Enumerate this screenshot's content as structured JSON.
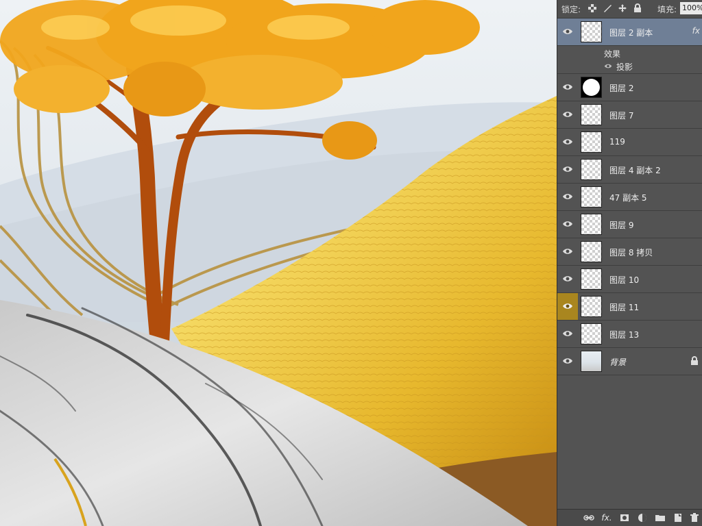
{
  "canvas": {
    "description_icons": [
      "tree",
      "gold-line-waves",
      "gold-hill",
      "marble-slope"
    ]
  },
  "panel": {
    "lock_label": "锁定:",
    "fill_label": "填充:",
    "fill_value": "100%",
    "lock_icons": [
      "lock-transparent-icon",
      "lock-brush-icon",
      "lock-move-icon",
      "lock-all-icon"
    ],
    "effects": {
      "title": "效果",
      "item": "投影"
    },
    "layers": [
      {
        "name": "图层 2 副本",
        "thumb": "checker",
        "selected": true,
        "fx": "fx"
      },
      {
        "name": "图层 2",
        "thumb": "circle"
      },
      {
        "name": "图层 7",
        "thumb": "checker"
      },
      {
        "name": "119",
        "thumb": "checker"
      },
      {
        "name": "图层 4 副本 2",
        "thumb": "checker"
      },
      {
        "name": "47 副本 5",
        "thumb": "checker"
      },
      {
        "name": "图层 9",
        "thumb": "checker"
      },
      {
        "name": "图层 8 拷贝",
        "thumb": "checker"
      },
      {
        "name": "图层 10",
        "thumb": "checker"
      },
      {
        "name": "图层 11",
        "thumb": "checker",
        "eye_highlight": true
      },
      {
        "name": "图层 13",
        "thumb": "checker"
      },
      {
        "name": "背景",
        "thumb": "bg",
        "italic": true,
        "locked": true
      }
    ],
    "bottom_icons": [
      "link-layers-icon",
      "fx-icon",
      "mask-icon",
      "adjustment-icon",
      "folder-icon",
      "new-layer-icon",
      "trash-icon"
    ],
    "bottom_fx_label": "fx."
  },
  "colors": {
    "panel_bg": "#535353",
    "selected_row": "#6f7f96",
    "eye_highlight": "#a9861f"
  }
}
